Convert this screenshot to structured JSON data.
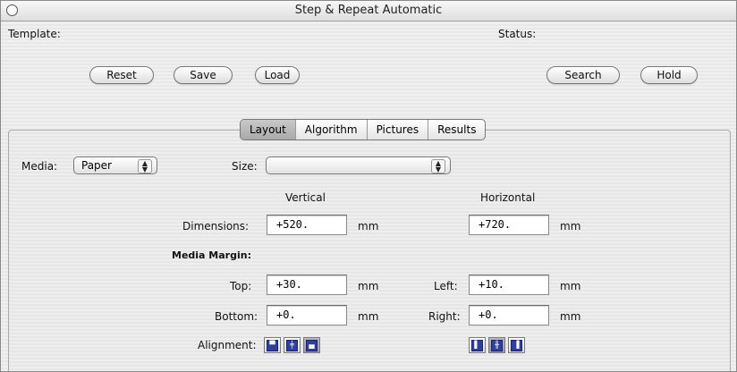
{
  "window": {
    "title": "Step & Repeat Automatic"
  },
  "header": {
    "template_label": "Template:",
    "status_label": "Status:",
    "buttons": {
      "reset": "Reset",
      "save": "Save",
      "load": "Load",
      "search": "Search",
      "hold": "Hold"
    }
  },
  "tabs": [
    {
      "label": "Layout",
      "active": true
    },
    {
      "label": "Algorithm",
      "active": false
    },
    {
      "label": "Pictures",
      "active": false
    },
    {
      "label": "Results",
      "active": false
    }
  ],
  "layout": {
    "media_label": "Media:",
    "media_value": "Paper",
    "size_label": "Size:",
    "size_value": "",
    "vertical_header": "Vertical",
    "horizontal_header": "Horizontal",
    "dimensions_label": "Dimensions:",
    "dimensions_vertical": "+520.",
    "dimensions_horizontal": "+720.",
    "unit": "mm",
    "media_margin_label": "Media Margin:",
    "top_label": "Top:",
    "top_value": "+30.",
    "left_label": "Left:",
    "left_value": "+10.",
    "bottom_label": "Bottom:",
    "bottom_value": "+0.",
    "right_label": "Right:",
    "right_value": "+0.",
    "alignment_label": "Alignment:"
  }
}
